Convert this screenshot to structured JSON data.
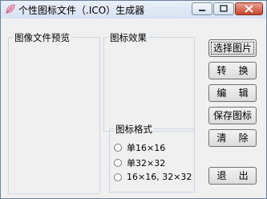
{
  "window": {
    "title": "个性图标文件（.ICO）生成器"
  },
  "groups": {
    "preview_label": "图像文件预览",
    "effect_label": "图标效果",
    "format_label": "图标格式"
  },
  "format_options": [
    {
      "label": "单16×16",
      "checked": false
    },
    {
      "label": "单32×32",
      "checked": false
    },
    {
      "label": "16×16, 32×32",
      "checked": false
    }
  ],
  "buttons": {
    "select_image": "选择图片",
    "convert": "转    换",
    "edit": "编    辑",
    "save_icon": "保存图标",
    "clear": "清    除",
    "exit": "退    出"
  },
  "icons": {
    "app": "leaf-icon",
    "minimize": "minimize-icon",
    "maximize": "maximize-icon",
    "close": "close-icon"
  },
  "colors": {
    "close_button": "#c9452b",
    "titlebar": "#d6e2f1"
  }
}
